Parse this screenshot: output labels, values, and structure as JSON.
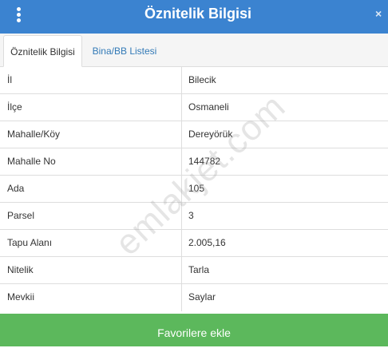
{
  "header": {
    "title": "Öznitelik Bilgisi",
    "close_glyph": "×",
    "menu_icon": "vertical-ellipsis-icon",
    "background_color": "#3b83d0"
  },
  "tabs": [
    {
      "label": "Öznitelik Bilgisi",
      "active": true
    },
    {
      "label": "Bina/BB Listesi",
      "active": false
    }
  ],
  "attributes": [
    {
      "label": "İl",
      "value": "Bilecik"
    },
    {
      "label": "İlçe",
      "value": "Osmaneli"
    },
    {
      "label": "Mahalle/Köy",
      "value": "Dereyörük"
    },
    {
      "label": "Mahalle No",
      "value": "144782"
    },
    {
      "label": "Ada",
      "value": "105"
    },
    {
      "label": "Parsel",
      "value": "3"
    },
    {
      "label": "Tapu Alanı",
      "value": "2.005,16"
    },
    {
      "label": "Nitelik",
      "value": "Tarla"
    },
    {
      "label": "Mevkii",
      "value": "Saylar"
    }
  ],
  "watermark": "emlakjet.com",
  "footer": {
    "favorite_label": "Favorilere ekle",
    "button_color": "#5cb85c"
  }
}
